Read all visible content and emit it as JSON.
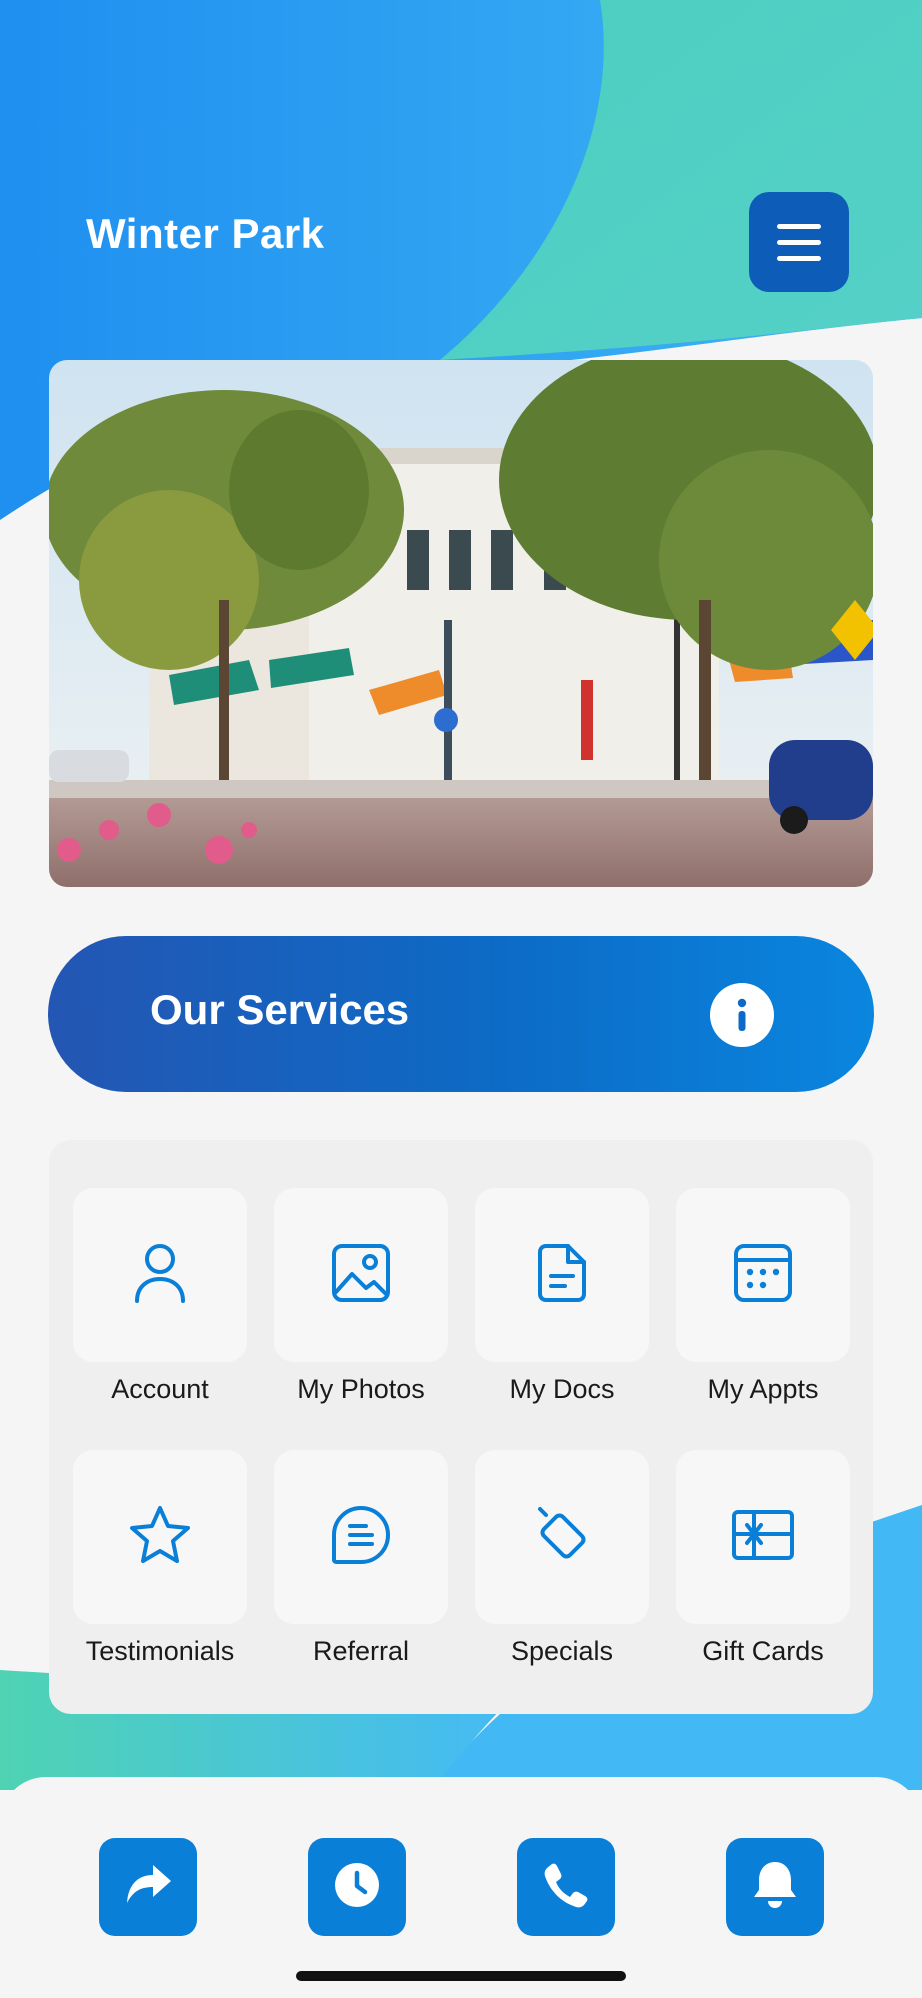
{
  "header": {
    "title": "Winter Park"
  },
  "hero": {
    "alt": "Winter Park street"
  },
  "services": {
    "title": "Our Services"
  },
  "grid": {
    "items": [
      {
        "label": "Account",
        "icon": "user-icon"
      },
      {
        "label": "My Photos",
        "icon": "photo-icon"
      },
      {
        "label": "My Docs",
        "icon": "document-icon"
      },
      {
        "label": "My Appts",
        "icon": "calendar-icon"
      },
      {
        "label": "Testimonials",
        "icon": "star-icon"
      },
      {
        "label": "Referral",
        "icon": "chat-icon"
      },
      {
        "label": "Specials",
        "icon": "tag-icon"
      },
      {
        "label": "Gift Cards",
        "icon": "gift-card-icon"
      }
    ]
  },
  "bottom_actions": [
    {
      "icon": "share-icon"
    },
    {
      "icon": "clock-icon"
    },
    {
      "icon": "phone-icon"
    },
    {
      "icon": "bell-icon"
    }
  ],
  "colors": {
    "primary": "#0a7fd8",
    "header_blue": "#2196f3",
    "teal": "#4ecdc4",
    "menu_button": "#0d5cb8"
  }
}
